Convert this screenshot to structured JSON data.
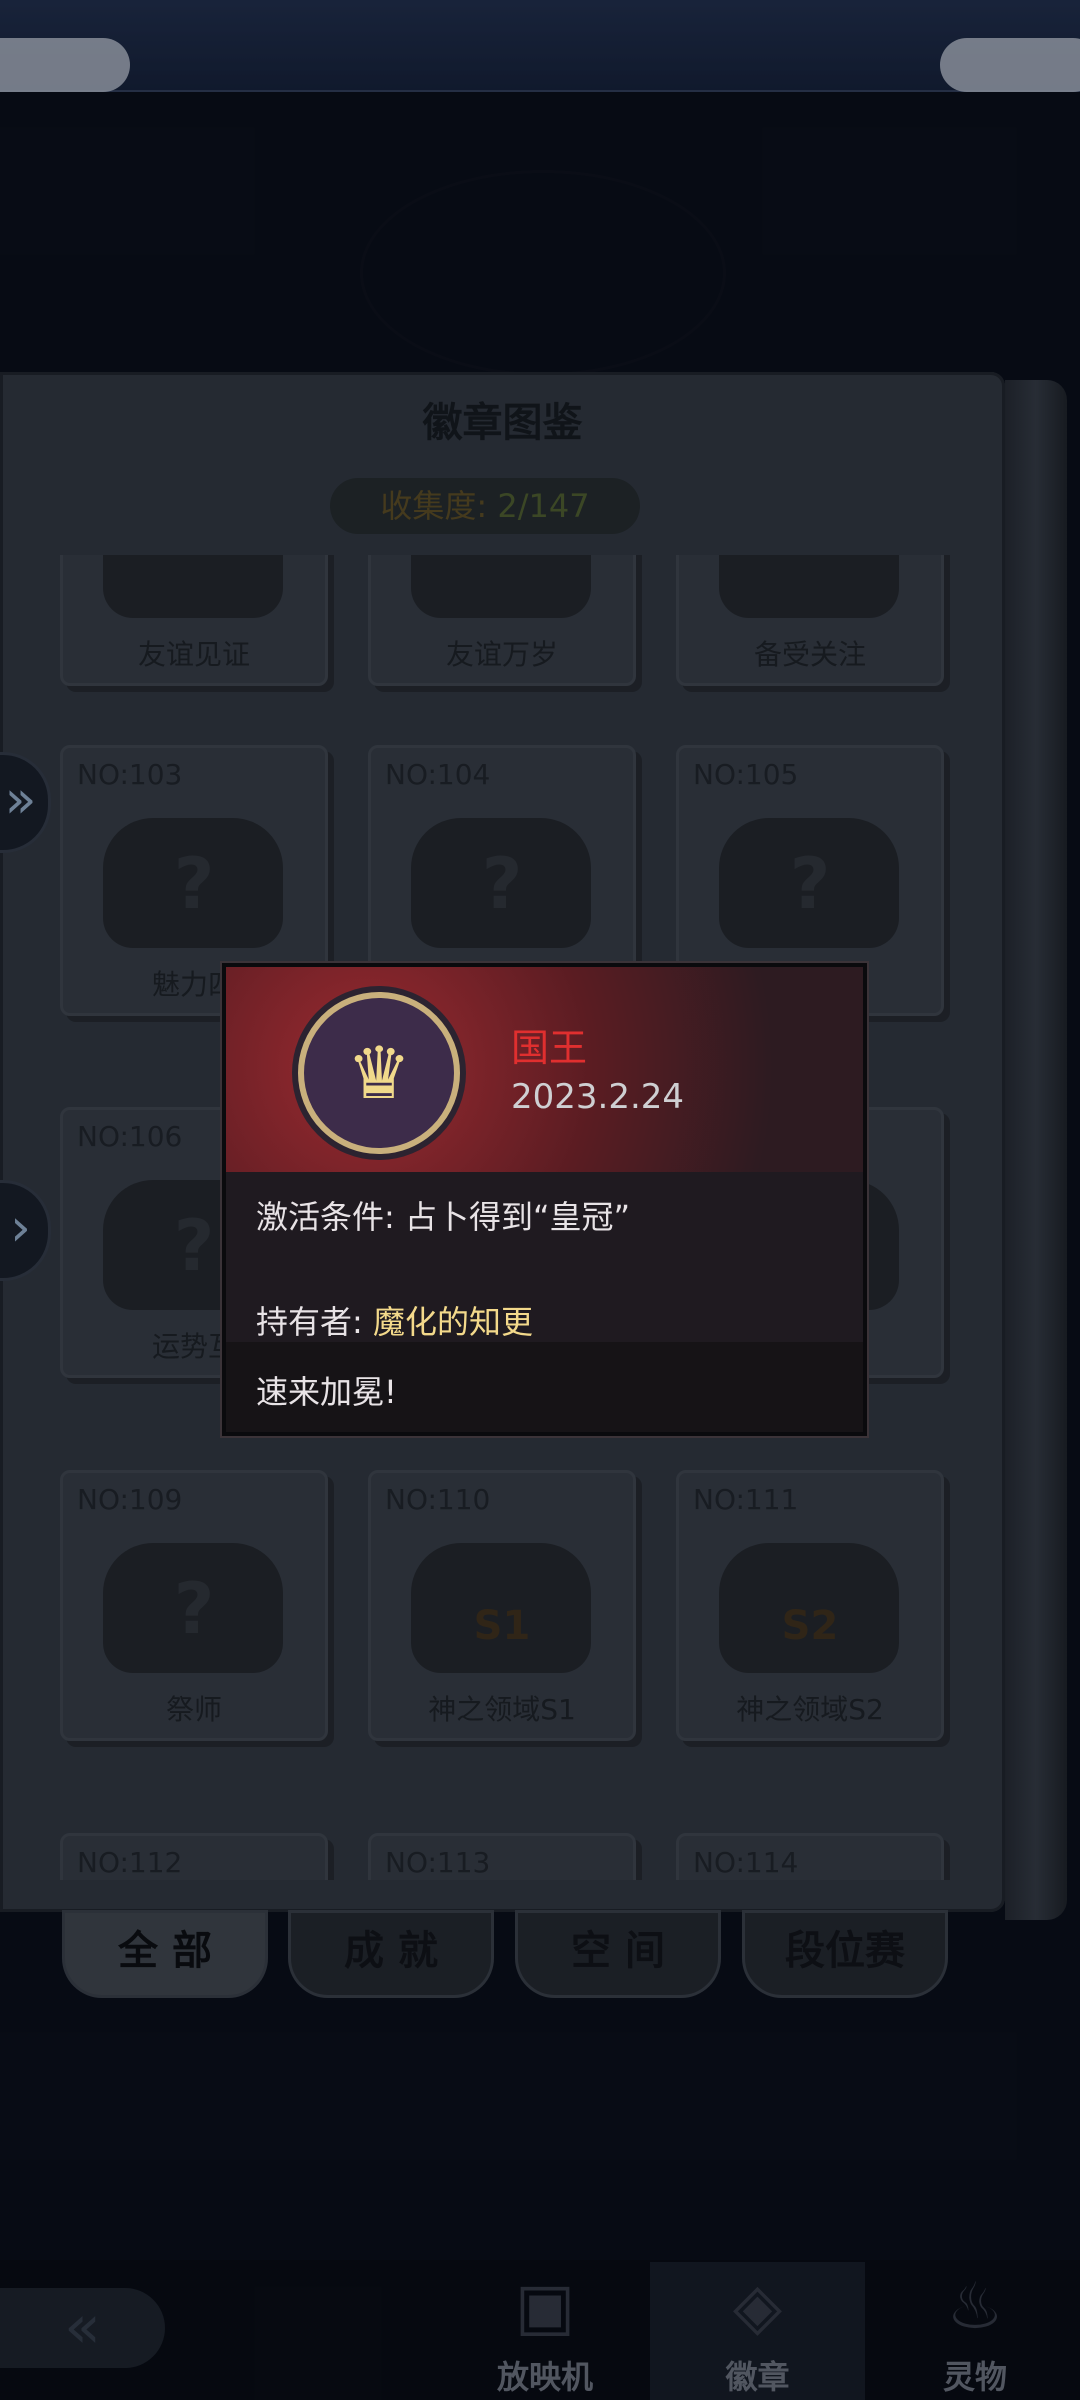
{
  "book": {
    "title": "徽章图鉴",
    "progress_label": "收集度:",
    "progress_value": "2/147"
  },
  "cards": [
    {
      "no": "",
      "name": "友谊见证",
      "unknown": false
    },
    {
      "no": "",
      "name": "友谊万岁",
      "unknown": false
    },
    {
      "no": "",
      "name": "备受关注",
      "unknown": false
    },
    {
      "no": "NO:103",
      "name": "魅力四",
      "unknown": true
    },
    {
      "no": "NO:104",
      "name": "",
      "unknown": true
    },
    {
      "no": "NO:105",
      "name": "",
      "unknown": true
    },
    {
      "no": "NO:106",
      "name": "运势互",
      "unknown": true
    },
    {
      "no": "NO:109",
      "name": "祭师",
      "unknown": true
    },
    {
      "no": "NO:110",
      "name": "神之领域S1",
      "unknown": false,
      "season": "S1"
    },
    {
      "no": "NO:111",
      "name": "神之领域S2",
      "unknown": false,
      "season": "S2"
    },
    {
      "no": "NO:112",
      "name": "",
      "unknown": false
    },
    {
      "no": "NO:113",
      "name": "",
      "unknown": false
    },
    {
      "no": "NO:114",
      "name": "",
      "unknown": false
    }
  ],
  "tabs": [
    "全 部",
    "成 就",
    "空 间",
    "段位赛"
  ],
  "nav": [
    {
      "label": "放映机",
      "icon": "projector-icon"
    },
    {
      "label": "徽章",
      "icon": "badge-icon"
    },
    {
      "label": "灵物",
      "icon": "spirit-icon"
    }
  ],
  "popup": {
    "badge_name": "国王",
    "date": "2023.2.24",
    "condition_label": "激活条件:",
    "condition_value": "占卜得到“皇冠”",
    "owner_label": "持有者:",
    "owner_value": "魔化的知更",
    "message": "速来加冕!"
  },
  "colors": {
    "accent_red": "#e02f2f",
    "owner_gold": "#f3d98b"
  }
}
